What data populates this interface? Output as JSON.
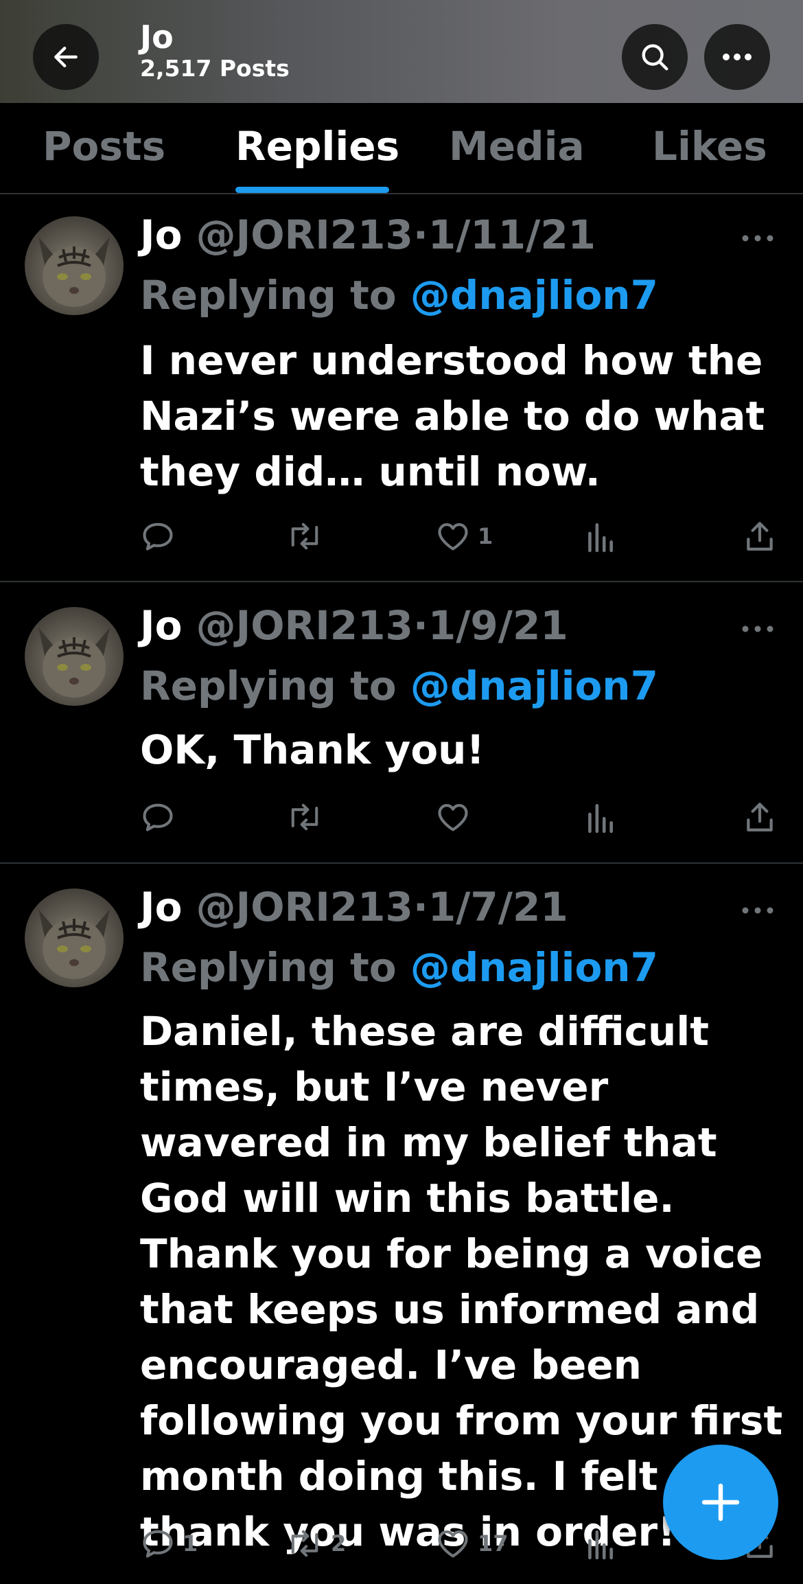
{
  "header": {
    "title": "Jo",
    "post_count": "2,517 Posts"
  },
  "tabs": [
    {
      "label": "Posts",
      "active": false
    },
    {
      "label": "Replies",
      "active": true
    },
    {
      "label": "Media",
      "active": false
    },
    {
      "label": "Likes",
      "active": false
    }
  ],
  "posts": [
    {
      "name": "Jo",
      "handle": "@JORI213",
      "separator": "·",
      "date": "1/11/21",
      "replying_prefix": "Replying to",
      "replying_to": "@dnajlion7",
      "text": "I never understood how the Nazi’s were able to do what they did… until now.",
      "reply_count": "",
      "repost_count": "",
      "like_count": "1"
    },
    {
      "name": "Jo",
      "handle": "@JORI213",
      "separator": "·",
      "date": "1/9/21",
      "replying_prefix": "Replying to",
      "replying_to": "@dnajlion7",
      "text": "OK, Thank you!",
      "reply_count": "",
      "repost_count": "",
      "like_count": ""
    },
    {
      "name": "Jo",
      "handle": "@JORI213",
      "separator": "·",
      "date": "1/7/21",
      "replying_prefix": "Replying to",
      "replying_to": "@dnajlion7",
      "text": "Daniel, these are difficult times, but I’ve never wavered in my belief that God will win this battle. Thank you for being a voice that keeps us informed and encouraged. I’ve been following you from your first month doing this. I felt a thank you was in order!",
      "reply_count": "1",
      "repost_count": "2",
      "like_count": "17"
    }
  ],
  "icons": {
    "back": "arrow-left-icon",
    "search": "search-icon",
    "more": "more-horizontal-icon",
    "reply": "reply-icon",
    "repost": "repost-icon",
    "like": "heart-icon",
    "views": "views-icon",
    "share": "share-icon",
    "compose": "plus-icon"
  },
  "colors": {
    "accent": "#1d9bf0",
    "background": "#000000",
    "muted": "#71767b",
    "text": "#ffffff"
  }
}
